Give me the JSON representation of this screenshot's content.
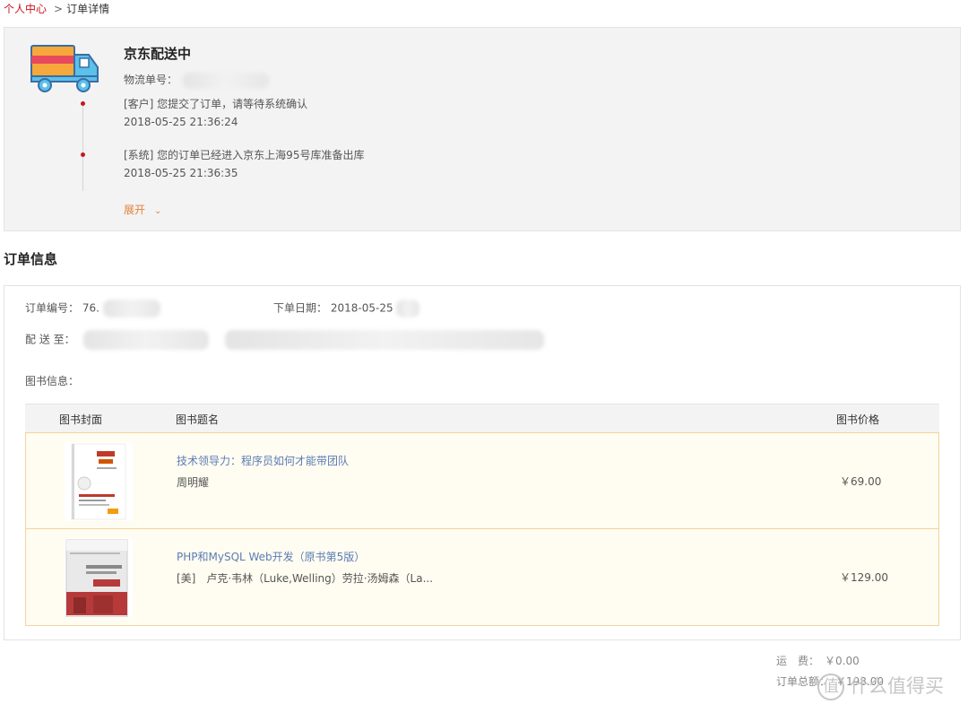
{
  "breadcrumb": {
    "home": "个人中心",
    "separator": ">",
    "current": "订单详情"
  },
  "tracking": {
    "status_title": "京东配送中",
    "tracking_no_label": "物流单号：",
    "events": [
      {
        "text": "[客户] 您提交了订单，请等待系统确认",
        "time": "2018-05-25 21:36:24"
      },
      {
        "text": "[系统] 您的订单已经进入京东上海95号库准备出库",
        "time": "2018-05-25 21:36:35"
      }
    ],
    "expand_label": "展开",
    "expand_icon": "chevron-down-icon"
  },
  "order_info": {
    "section_title": "订单信息",
    "order_no_label": "订单编号：",
    "order_no_value": "76.",
    "order_date_label": "下单日期：",
    "order_date_value": "2018-05-25",
    "ship_to_label": "配 送 至：",
    "books_label": "图书信息："
  },
  "table": {
    "headers": {
      "cover": "图书封面",
      "title": "图书题名",
      "price": "图书价格"
    },
    "rows": [
      {
        "title": "技术领导力：程序员如何才能带团队",
        "author": "周明耀",
        "price": "￥69.00"
      },
      {
        "title": "PHP和MySQL Web开发（原书第5版）",
        "author": "[美]　卢克·韦林（Luke,Welling）劳拉·汤姆森（La...",
        "price": "￥129.00"
      }
    ]
  },
  "summary": {
    "shipping_label": "运　费：",
    "shipping_value": "￥0.00",
    "total_label": "订单总额：",
    "total_value": "￥198.00"
  },
  "watermark": {
    "icon_char": "值",
    "text": "什么值得买"
  },
  "colors": {
    "accent_red": "#c81623",
    "link_blue": "#5a7cb5",
    "expand_orange": "#e4803b",
    "row_border": "#f1d59b"
  }
}
